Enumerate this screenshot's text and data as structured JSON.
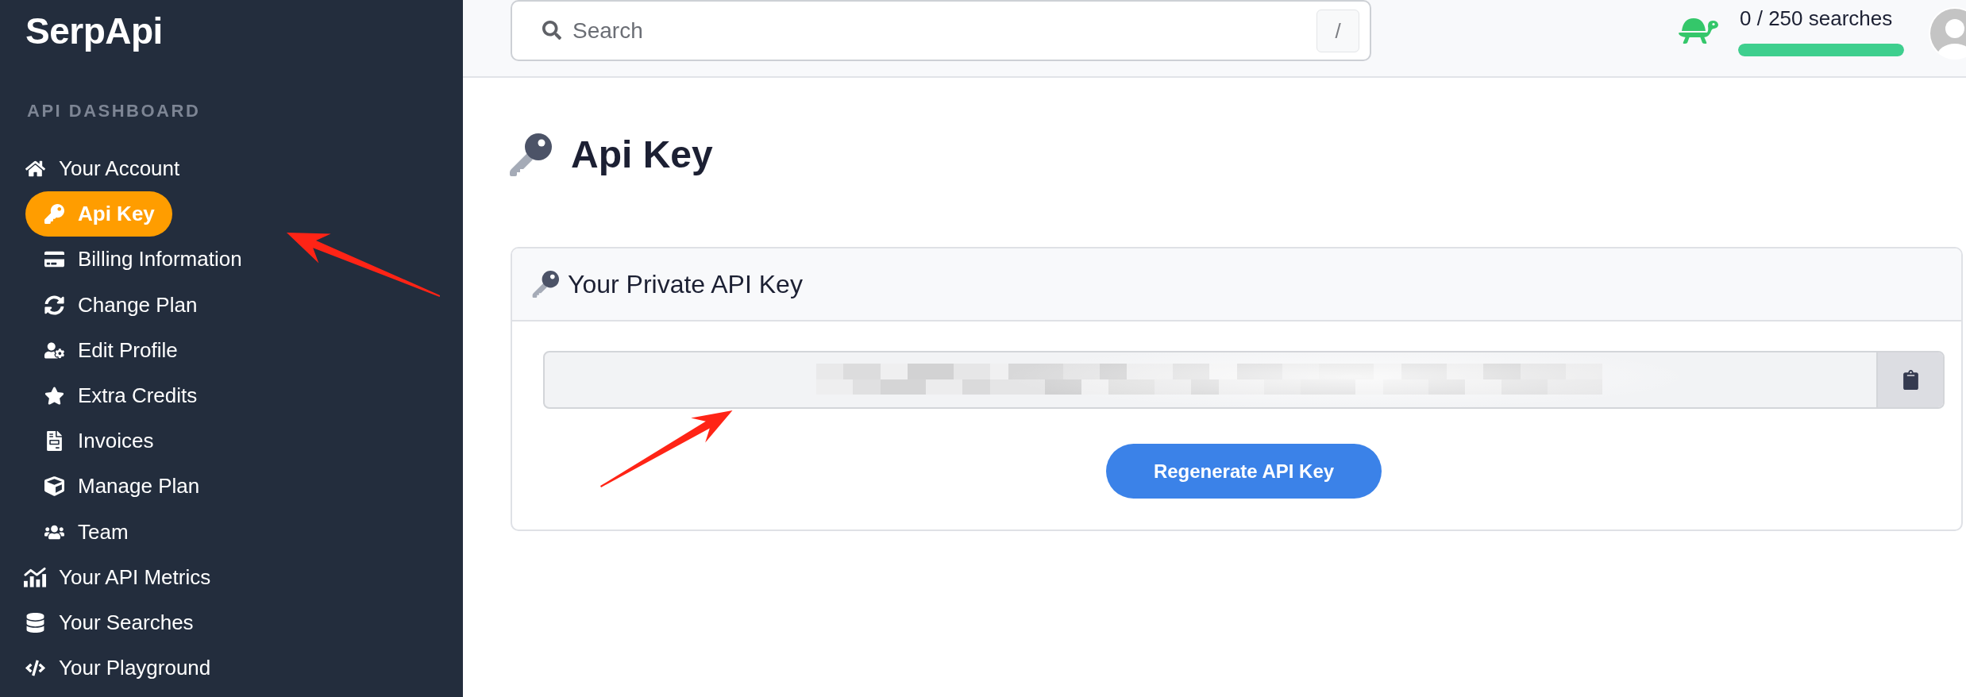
{
  "sidebar": {
    "logo": "SerpApi",
    "section_title": "API DASHBOARD",
    "items": [
      {
        "label": "Your Account",
        "selected": false,
        "children": [
          {
            "label": "Api Key",
            "selected": true
          },
          {
            "label": "Billing Information",
            "selected": false
          },
          {
            "label": "Change Plan",
            "selected": false
          },
          {
            "label": "Edit Profile",
            "selected": false
          },
          {
            "label": "Extra Credits",
            "selected": false
          },
          {
            "label": "Invoices",
            "selected": false
          },
          {
            "label": "Manage Plan",
            "selected": false
          },
          {
            "label": "Team",
            "selected": false
          }
        ]
      },
      {
        "label": "Your API Metrics",
        "selected": false
      },
      {
        "label": "Your Searches",
        "selected": false
      },
      {
        "label": "Your Playground",
        "selected": false
      }
    ]
  },
  "top_bar": {
    "search": {
      "placeholder": "Search",
      "shortcut": "/"
    },
    "usage": {
      "text": "0 / 250 searches",
      "level": 1
    }
  },
  "page": {
    "title": "Api Key"
  },
  "api_key_card": {
    "title": "Your Private API Key",
    "key_field": {
      "redacted": true
    },
    "regenerate_button": "Regenerate API Key"
  },
  "annotations": [
    {
      "kind": "arrow"
    },
    {
      "kind": "arrow"
    }
  ]
}
